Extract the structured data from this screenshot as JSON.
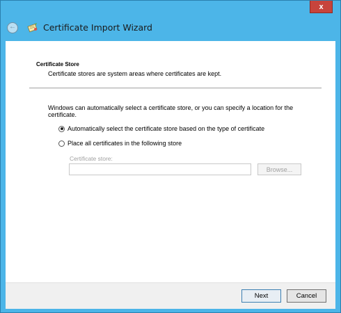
{
  "window": {
    "title": "Certificate Import Wizard",
    "close_label": "x",
    "back_label": "←"
  },
  "section": {
    "title": "Certificate Store",
    "description": "Certificate stores are system areas where certificates are kept."
  },
  "body_text": "Windows can automatically select a certificate store, or you can specify a location for the certificate.",
  "options": [
    {
      "label": "Automatically select the certificate store based on the type of certificate",
      "checked": true
    },
    {
      "label": "Place all certificates in the following store",
      "checked": false
    }
  ],
  "store": {
    "label": "Certificate store:",
    "value": "",
    "browse_label": "Browse..."
  },
  "footer": {
    "next_label": "Next",
    "cancel_label": "Cancel"
  }
}
